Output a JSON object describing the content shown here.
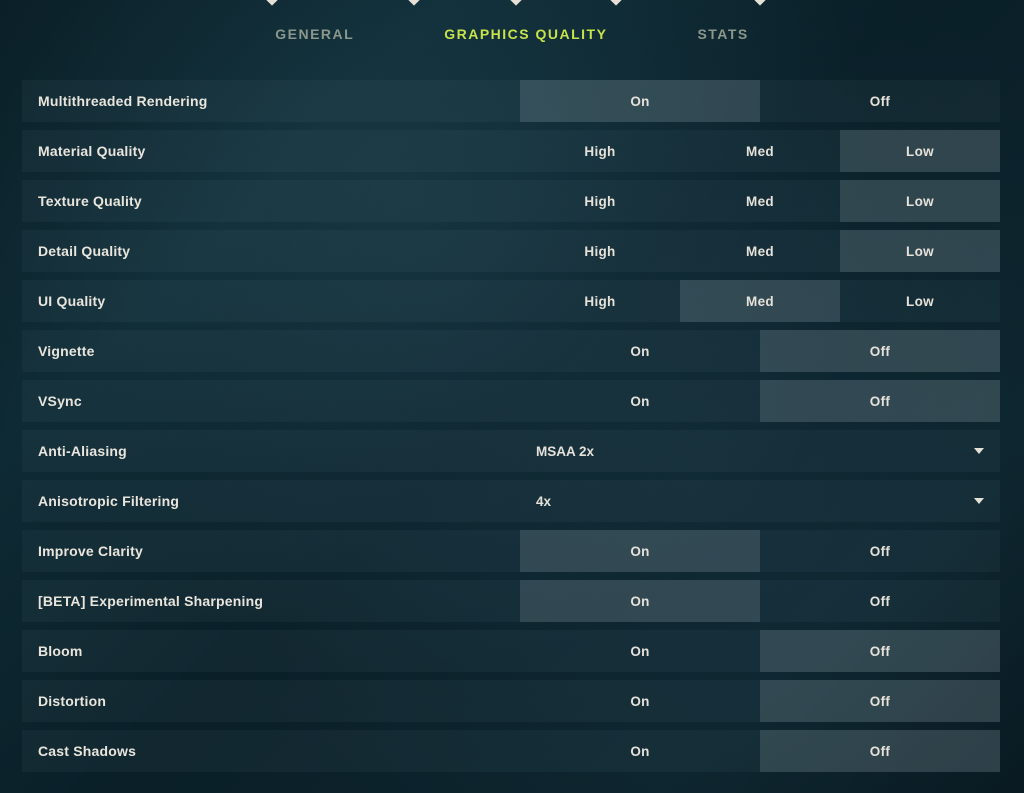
{
  "tabs": {
    "general": "GENERAL",
    "graphics": "GRAPHICS QUALITY",
    "stats": "STATS"
  },
  "opts": {
    "on": "On",
    "off": "Off",
    "high": "High",
    "med": "Med",
    "low": "Low"
  },
  "rows": {
    "multithreaded": {
      "label": "Multithreaded Rendering"
    },
    "material": {
      "label": "Material Quality"
    },
    "texture": {
      "label": "Texture Quality"
    },
    "detail": {
      "label": "Detail Quality"
    },
    "ui": {
      "label": "UI Quality"
    },
    "vignette": {
      "label": "Vignette"
    },
    "vsync": {
      "label": "VSync"
    },
    "aa": {
      "label": "Anti-Aliasing",
      "value": "MSAA 2x"
    },
    "aniso": {
      "label": "Anisotropic Filtering",
      "value": "4x"
    },
    "clarity": {
      "label": "Improve Clarity"
    },
    "sharpen": {
      "label": "[BETA] Experimental Sharpening"
    },
    "bloom": {
      "label": "Bloom"
    },
    "distortion": {
      "label": "Distortion"
    },
    "shadows": {
      "label": "Cast Shadows"
    }
  }
}
